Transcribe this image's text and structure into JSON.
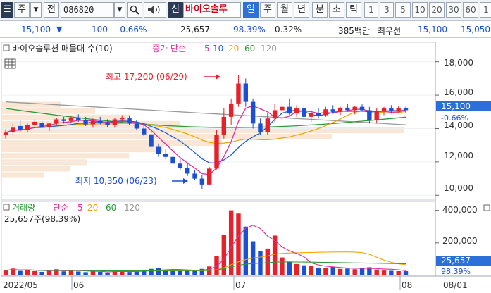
{
  "toolbar": {
    "market_type": "주",
    "sub_type": "전",
    "code": "086820",
    "code_dropdown": "▾",
    "search_icon": "🔍",
    "sound_icon": "◀",
    "new_tag": "신",
    "stock_name": "바이오솔루",
    "periods": [
      "일",
      "주",
      "월",
      "년",
      "분",
      "초",
      "틱"
    ],
    "intervals": [
      "1",
      "3",
      "5",
      "10",
      "20",
      "30",
      "60",
      "1"
    ]
  },
  "quote": {
    "price": "15,100",
    "direction": "▼",
    "change": "100",
    "change_pct": "-0.66%",
    "volume": "25,657",
    "volume_ratio": "98.39%",
    "turnover_pct": "0.32%",
    "trade_value": "385백만",
    "best_bid_label": "최우선",
    "bid": "15,100",
    "ask": "15,050"
  },
  "price_panel": {
    "legend_title": "바이오솔루션 매물대 수(10)",
    "legend_ma_prefix": "종가 단순",
    "ma_periods": [
      "5",
      "10",
      "20",
      "60",
      "120"
    ],
    "high_annotation": "최고 17,200 (06/29)",
    "low_annotation": "최저 10,350 (06/23)",
    "axis_labels": [
      "18,000",
      "16,000",
      "14,000",
      "12,000",
      "10,000"
    ],
    "current_price_tag": "15,100",
    "current_change_tag": "-0.66%"
  },
  "volume_panel": {
    "legend_title": "거래량",
    "legend_ma_prefix": "단순",
    "ma_periods": [
      "5",
      "20",
      "60",
      "120"
    ],
    "info": "25,657주(98.39%)",
    "axis_labels": [
      "400,000",
      "200,000"
    ],
    "current_volume_tag": "25,657",
    "current_ratio_tag": "98.39%"
  },
  "x_axis": {
    "labels": [
      "2022/05",
      "06",
      "07",
      "08",
      "08/01"
    ]
  },
  "colors": {
    "up": "#e8202a",
    "down": "#1a4fd6",
    "ma5": "#e0309a",
    "ma10": "#1f5fd1",
    "ma20": "#f0a800",
    "ma60": "#2e9a3c",
    "ma120": "#9a9a9a",
    "volume_profile": "#f8e2cc",
    "price_tag_bg": "#2b6fd8"
  },
  "chart_data": {
    "type": "candlestick",
    "ylim": [
      9800,
      19000
    ],
    "volume_ylim": [
      0,
      420000
    ],
    "candles": [
      {
        "o": 13600,
        "h": 13950,
        "l": 13400,
        "c": 13750
      },
      {
        "o": 13800,
        "h": 14300,
        "l": 13650,
        "c": 14050
      },
      {
        "o": 14150,
        "h": 14500,
        "l": 13800,
        "c": 13900
      },
      {
        "o": 13900,
        "h": 14300,
        "l": 13750,
        "c": 14200
      },
      {
        "o": 14200,
        "h": 14550,
        "l": 14000,
        "c": 14400
      },
      {
        "o": 14350,
        "h": 14500,
        "l": 14000,
        "c": 14100
      },
      {
        "o": 14100,
        "h": 14350,
        "l": 13850,
        "c": 14300
      },
      {
        "o": 14300,
        "h": 14650,
        "l": 14200,
        "c": 14550
      },
      {
        "o": 14550,
        "h": 14700,
        "l": 14300,
        "c": 14450
      },
      {
        "o": 14450,
        "h": 14750,
        "l": 14300,
        "c": 14650
      },
      {
        "o": 14650,
        "h": 14850,
        "l": 14400,
        "c": 14500
      },
      {
        "o": 14500,
        "h": 14700,
        "l": 14150,
        "c": 14250
      },
      {
        "o": 14250,
        "h": 14600,
        "l": 14050,
        "c": 14450
      },
      {
        "o": 14450,
        "h": 14700,
        "l": 14250,
        "c": 14350
      },
      {
        "o": 14350,
        "h": 14550,
        "l": 14100,
        "c": 14200
      },
      {
        "o": 14200,
        "h": 14650,
        "l": 14050,
        "c": 14550
      },
      {
        "o": 14550,
        "h": 14800,
        "l": 14400,
        "c": 14650
      },
      {
        "o": 14650,
        "h": 14800,
        "l": 14200,
        "c": 14300
      },
      {
        "o": 14300,
        "h": 14500,
        "l": 13900,
        "c": 14000
      },
      {
        "o": 14000,
        "h": 14300,
        "l": 13550,
        "c": 13650
      },
      {
        "o": 13650,
        "h": 13800,
        "l": 12800,
        "c": 12900
      },
      {
        "o": 12900,
        "h": 13100,
        "l": 12300,
        "c": 12500
      },
      {
        "o": 12500,
        "h": 12800,
        "l": 12150,
        "c": 12300
      },
      {
        "o": 12300,
        "h": 12600,
        "l": 11800,
        "c": 11900
      },
      {
        "o": 11900,
        "h": 12200,
        "l": 11500,
        "c": 11650
      },
      {
        "o": 11650,
        "h": 11900,
        "l": 11150,
        "c": 11300
      },
      {
        "o": 11300,
        "h": 11500,
        "l": 10900,
        "c": 11000
      },
      {
        "o": 11000,
        "h": 11200,
        "l": 10350,
        "c": 10650
      },
      {
        "o": 10650,
        "h": 11700,
        "l": 10600,
        "c": 11600
      },
      {
        "o": 11600,
        "h": 13900,
        "l": 11550,
        "c": 13600
      },
      {
        "o": 13600,
        "h": 15200,
        "l": 13400,
        "c": 14700
      },
      {
        "o": 14700,
        "h": 15800,
        "l": 14200,
        "c": 15500
      },
      {
        "o": 15500,
        "h": 17200,
        "l": 15300,
        "c": 16700
      },
      {
        "o": 16700,
        "h": 17000,
        "l": 15300,
        "c": 15600
      },
      {
        "o": 15600,
        "h": 15800,
        "l": 14000,
        "c": 14300
      },
      {
        "o": 14300,
        "h": 14600,
        "l": 13600,
        "c": 13800
      },
      {
        "o": 13800,
        "h": 14900,
        "l": 13600,
        "c": 14600
      },
      {
        "o": 14600,
        "h": 15500,
        "l": 14400,
        "c": 15100
      },
      {
        "o": 15100,
        "h": 15700,
        "l": 14900,
        "c": 15300
      },
      {
        "o": 15300,
        "h": 15800,
        "l": 14800,
        "c": 14900
      },
      {
        "o": 14900,
        "h": 15400,
        "l": 14700,
        "c": 15200
      },
      {
        "o": 15200,
        "h": 15500,
        "l": 14500,
        "c": 14700
      },
      {
        "o": 14700,
        "h": 15100,
        "l": 14400,
        "c": 14950
      },
      {
        "o": 14950,
        "h": 15200,
        "l": 14600,
        "c": 14800
      },
      {
        "o": 14800,
        "h": 15300,
        "l": 14700,
        "c": 15150
      },
      {
        "o": 15150,
        "h": 15400,
        "l": 14900,
        "c": 15000
      },
      {
        "o": 15000,
        "h": 15300,
        "l": 14800,
        "c": 15250
      },
      {
        "o": 15250,
        "h": 15500,
        "l": 15000,
        "c": 15100
      },
      {
        "o": 15100,
        "h": 15350,
        "l": 14850,
        "c": 15300
      },
      {
        "o": 15300,
        "h": 15450,
        "l": 15000,
        "c": 15100
      },
      {
        "o": 15100,
        "h": 15300,
        "l": 14300,
        "c": 14500
      },
      {
        "o": 14500,
        "h": 15200,
        "l": 14300,
        "c": 15050
      },
      {
        "o": 15050,
        "h": 15300,
        "l": 14800,
        "c": 15200
      },
      {
        "o": 15200,
        "h": 15400,
        "l": 14900,
        "c": 15050
      },
      {
        "o": 15050,
        "h": 15350,
        "l": 14950,
        "c": 15200
      },
      {
        "o": 15200,
        "h": 15300,
        "l": 14950,
        "c": 15100
      }
    ],
    "volumes": [
      30000,
      42000,
      28000,
      35000,
      26000,
      22000,
      30000,
      38000,
      25000,
      32000,
      24000,
      20000,
      27000,
      22000,
      18000,
      30000,
      26000,
      21000,
      24000,
      32000,
      40000,
      45000,
      30000,
      36000,
      28000,
      30000,
      33000,
      40000,
      55000,
      120000,
      250000,
      400000,
      380000,
      300000,
      210000,
      150000,
      165000,
      245000,
      110000,
      85000,
      70000,
      62000,
      58000,
      48000,
      44000,
      52000,
      40000,
      42000,
      38000,
      44000,
      50000,
      36000,
      30000,
      28000,
      26000,
      25657
    ],
    "volume_profile": [
      0.14,
      0.22,
      0.3,
      0.42,
      0.95,
      0.78,
      0.52,
      0.38,
      0.3,
      0.2,
      0.16,
      0.1
    ],
    "xlabels": [
      "2022/05",
      "06",
      "07",
      "08",
      "08/01"
    ]
  }
}
